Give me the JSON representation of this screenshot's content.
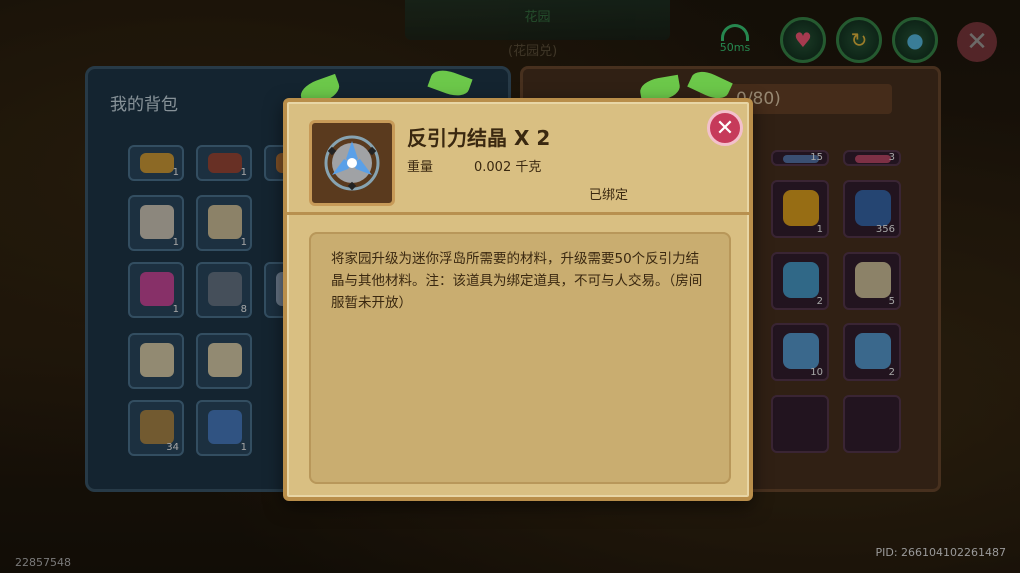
{
  "top": {
    "title": "花园",
    "subtitle": "(花园兑)",
    "latency": "50ms"
  },
  "backpack": {
    "title": "我的背包",
    "items": [
      {
        "count": "1",
        "color": "#d8a23a"
      },
      {
        "count": "1",
        "color": "#a04a3a"
      },
      {
        "count": "",
        "color": "#c07a3a"
      },
      {
        "count": "1",
        "color": "#d8d0c0"
      },
      {
        "count": "1",
        "color": "#d8c8a0"
      },
      {
        "count": "1",
        "color": "#d04aa0"
      },
      {
        "count": "8",
        "color": "#6a7a8a"
      },
      {
        "count": "",
        "color": "#9ab0c8"
      },
      {
        "count": "",
        "color": "#e0d4b0"
      },
      {
        "count": "",
        "color": "#e0d4b0"
      },
      {
        "count": "34",
        "color": "#b08a4a"
      },
      {
        "count": "1",
        "color": "#4a80c8"
      }
    ]
  },
  "right_panel": {
    "header": "0/80)",
    "items": [
      {
        "count": "15",
        "color": "#5a7ab0"
      },
      {
        "count": "3",
        "color": "#c04a6a"
      },
      {
        "count": "1",
        "color": "#e8a820"
      },
      {
        "count": "356",
        "color": "#3a6ab0"
      },
      {
        "count": "2",
        "color": "#4aa0d0"
      },
      {
        "count": "5",
        "color": "#d8c8a0"
      },
      {
        "count": "10",
        "color": "#5aa0d8"
      },
      {
        "count": "2",
        "color": "#5aa0d8"
      }
    ]
  },
  "modal": {
    "item_name": "反引力结晶 X 2",
    "weight_label": "重量",
    "weight_value": "0.002 千克",
    "bound_status": "已绑定",
    "description": "将家园升级为迷你浮岛所需要的材料，升级需要50个反引力结晶与其他材料。注：该道具为绑定道具，不可与人交易。（房间服暂未开放）",
    "close_symbol": "✕",
    "icon": "antigravity-crystal-icon"
  },
  "footer": {
    "pid": "PID: 266104102261487",
    "uid": "22857548"
  },
  "colors": {
    "modal_bg": "#d9bf82",
    "close_button": "#c63a5a",
    "text": "#3a2810"
  }
}
